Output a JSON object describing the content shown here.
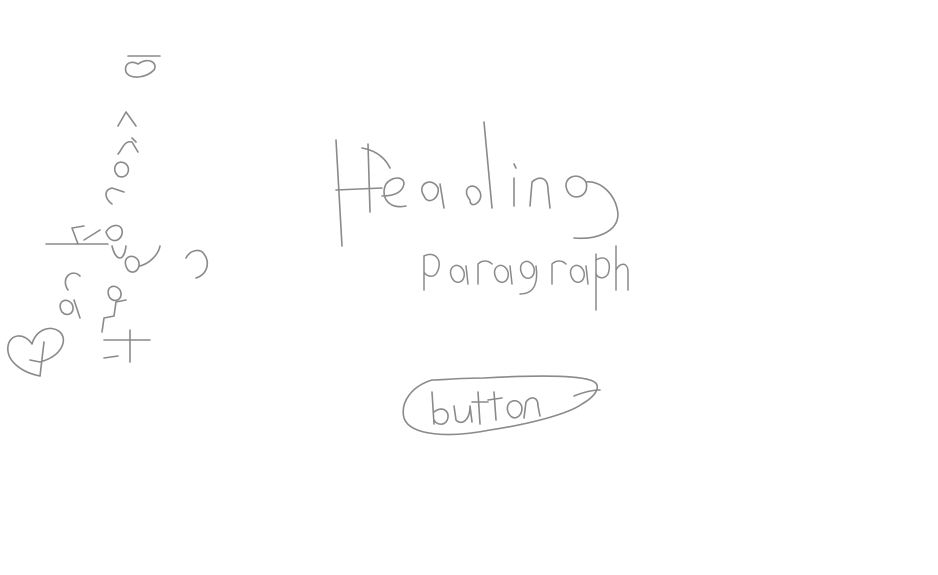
{
  "sketch": {
    "stroke_color": "#8a8a8a",
    "background_color": "#ffffff",
    "side_label": "Background Image",
    "heading": "Heading",
    "paragraph": "paragraph",
    "button_label": "button"
  }
}
